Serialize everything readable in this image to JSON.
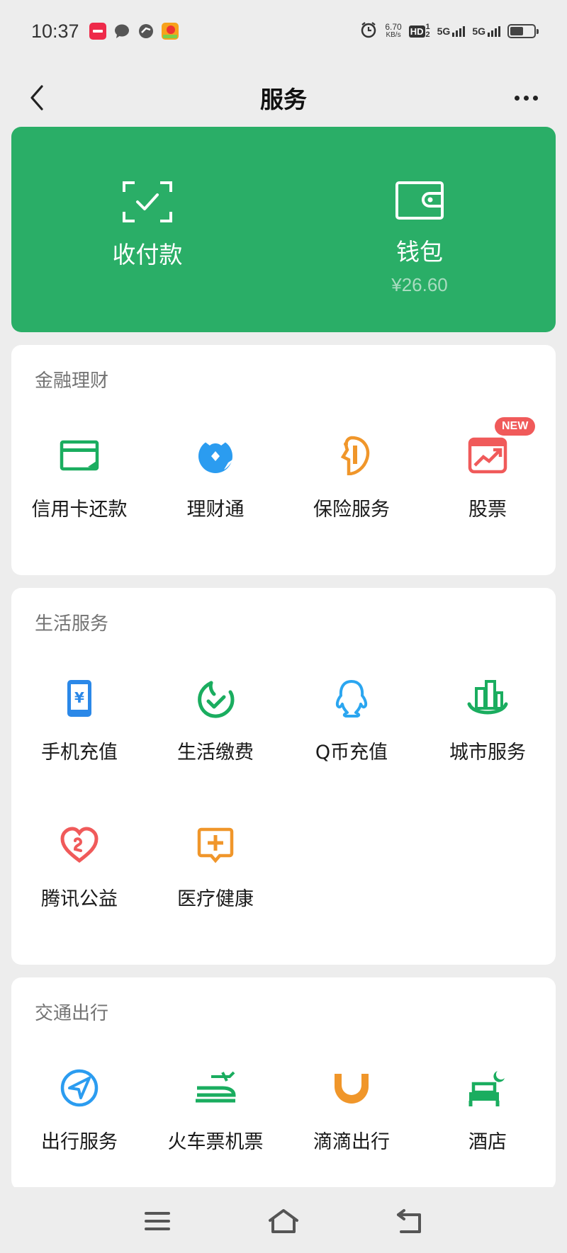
{
  "status": {
    "time": "10:37",
    "speed_value": "6.70",
    "speed_unit": "KB/s",
    "hd_label": "HD",
    "hd_sub_top": "1",
    "hd_sub_bottom": "2",
    "sim1_label": "5G",
    "sim2_label": "5G",
    "battery_level": 0.55
  },
  "nav": {
    "title": "服务"
  },
  "banner": {
    "pay": {
      "label": "收付款"
    },
    "wallet": {
      "label": "钱包",
      "balance": "¥26.60"
    }
  },
  "sections": {
    "finance": {
      "title": "金融理财",
      "items": [
        {
          "label": "信用卡还款",
          "icon": "credit-card-icon",
          "color": "#1aad5f"
        },
        {
          "label": "理财通",
          "icon": "wealth-icon",
          "color": "#2b9cf0"
        },
        {
          "label": "保险服务",
          "icon": "insurance-icon",
          "color": "#f0962a"
        },
        {
          "label": "股票",
          "icon": "stock-icon",
          "color": "#f05a5a",
          "badge": "NEW"
        }
      ]
    },
    "life": {
      "title": "生活服务",
      "items": [
        {
          "label": "手机充值",
          "icon": "phone-recharge-icon",
          "color": "#2b88e8"
        },
        {
          "label": "生活缴费",
          "icon": "utility-bill-icon",
          "color": "#1aad5f"
        },
        {
          "label": "Q币充值",
          "icon": "qq-coin-icon",
          "color": "#2ba6f0"
        },
        {
          "label": "城市服务",
          "icon": "city-service-icon",
          "color": "#1aad5f"
        },
        {
          "label": "腾讯公益",
          "icon": "charity-icon",
          "color": "#f05a5a"
        },
        {
          "label": "医疗健康",
          "icon": "medical-icon",
          "color": "#f0962a"
        }
      ]
    },
    "travel": {
      "title": "交通出行",
      "items": [
        {
          "label": "出行服务",
          "icon": "travel-service-icon",
          "color": "#2b9cf0"
        },
        {
          "label": "火车票机票",
          "icon": "train-plane-ticket-icon",
          "color": "#1aad5f"
        },
        {
          "label": "滴滴出行",
          "icon": "didi-icon",
          "color": "#f0962a"
        },
        {
          "label": "酒店",
          "icon": "hotel-icon",
          "color": "#1aad5f"
        }
      ]
    }
  },
  "colors": {
    "accent_green": "#2aae67",
    "background": "#ededed"
  }
}
